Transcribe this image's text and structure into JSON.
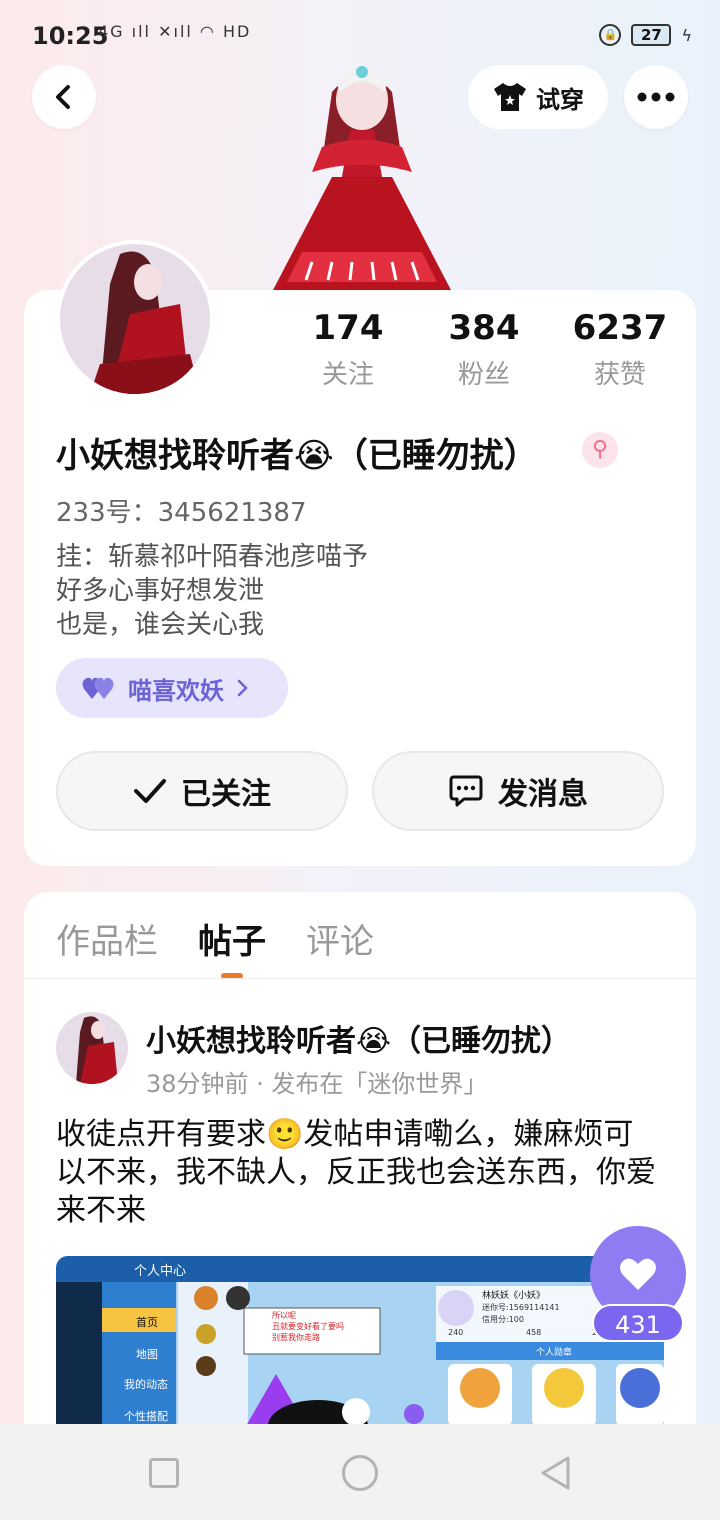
{
  "status_bar": {
    "time": "10:25",
    "network_icons": "4G ıll ✕ıll ◠ HD",
    "battery": "27"
  },
  "top_nav": {
    "tryon_label": "试穿"
  },
  "profile": {
    "stats": [
      {
        "value": "174",
        "label": "关注"
      },
      {
        "value": "384",
        "label": "粉丝"
      },
      {
        "value": "6237",
        "label": "获赞"
      }
    ],
    "nickname": "小妖想找聆听者😭（已睡勿扰）",
    "gender_symbol": "⚲",
    "uid": "233号：345621387",
    "bio": [
      "挂：斩慕祁叶陌春池彦喵予",
      "好多心事好想发泄",
      "也是，谁会关心我"
    ],
    "fan_badge": "喵喜欢妖",
    "followed_label": "已关注",
    "message_label": "发消息"
  },
  "tabs": [
    {
      "label": "作品栏"
    },
    {
      "label": "帖子"
    },
    {
      "label": "评论"
    }
  ],
  "post": {
    "author": "小妖想找聆听者😭（已睡勿扰）",
    "meta": "38分钟前 · 发布在「迷你世界」",
    "text": "收徒点开有要求🙂发帖申请嘞么，嫌麻烦可以不来，我不缺人，反正我也会送东西，你爱来不来",
    "image": {
      "menu_title": "个人中心",
      "sidebar_items": [
        "首页",
        "地图",
        "我的动态",
        "个性搭配"
      ],
      "popup_text": "所以呢\n丑就要变好看了要吗\n别惹我你走路",
      "user_name": "林妖妖《小妖》",
      "user_id": "迷你号:1569114141",
      "credit": "信用分:100",
      "counts": [
        "240",
        "458",
        "215"
      ],
      "honor_title": "个人勋章"
    },
    "like_count": "431"
  },
  "colors": {
    "accent": "#f07a2c",
    "like": "#8f7cf3",
    "fan_badge_text": "#6b63d6"
  }
}
